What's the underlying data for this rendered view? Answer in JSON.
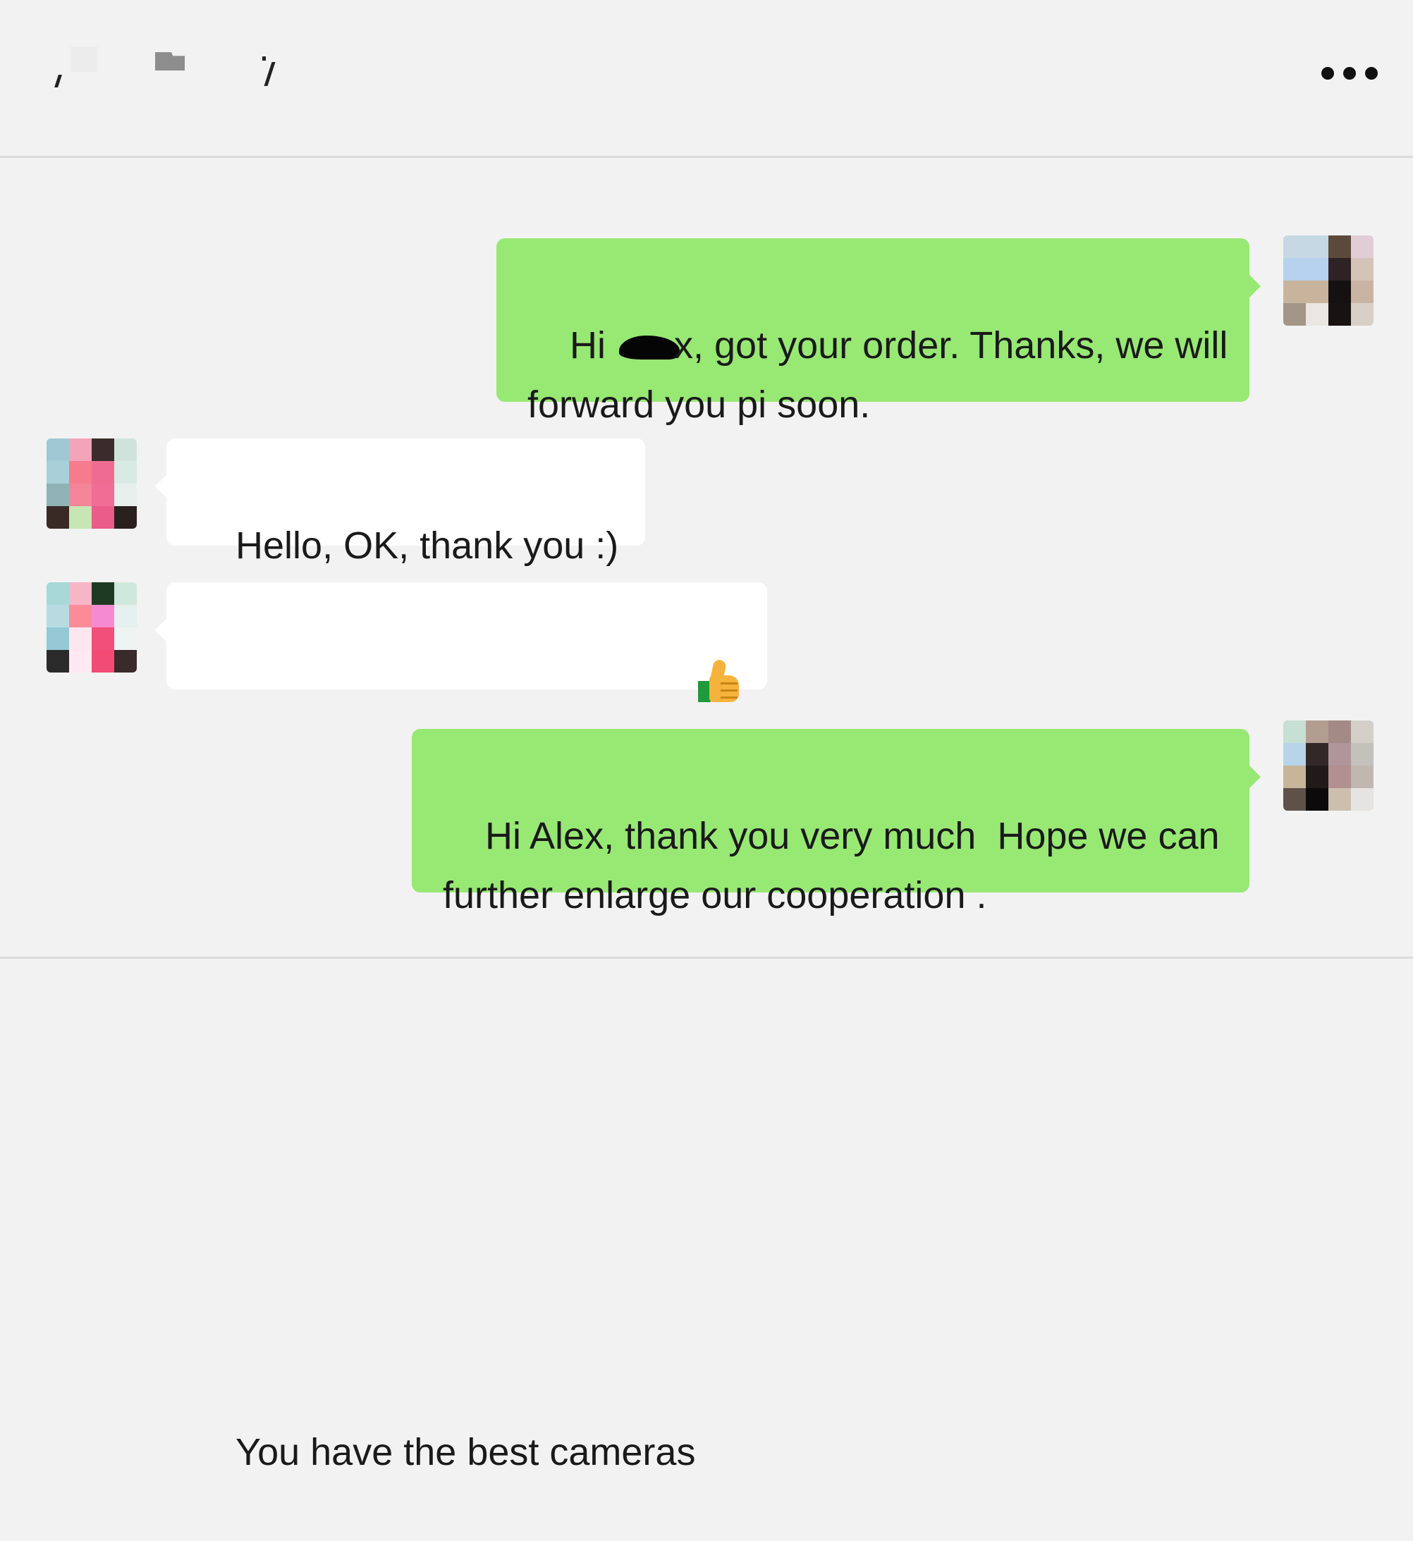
{
  "header": {
    "title": "",
    "more_icon": "more-horizontal-icon"
  },
  "messages": [
    {
      "direction": "sent",
      "text_before_redaction": "Hi ",
      "text_after_redaction": "x, got your order. Thanks, we will\nforward you pi soon."
    },
    {
      "direction": "received",
      "text": "Hello, OK, thank you :)"
    },
    {
      "direction": "received",
      "text": "You have the best cameras",
      "emoji": "thumbs-up-icon"
    },
    {
      "direction": "sent",
      "text": "Hi Alex, thank you very much  Hope we can\nfurther enlarge our cooperation ."
    }
  ],
  "colors": {
    "background": "#f2f2f2",
    "sent_bubble": "#98e874",
    "received_bubble": "#ffffff",
    "divider": "#dcdcdc",
    "text": "#1a1a1a"
  }
}
